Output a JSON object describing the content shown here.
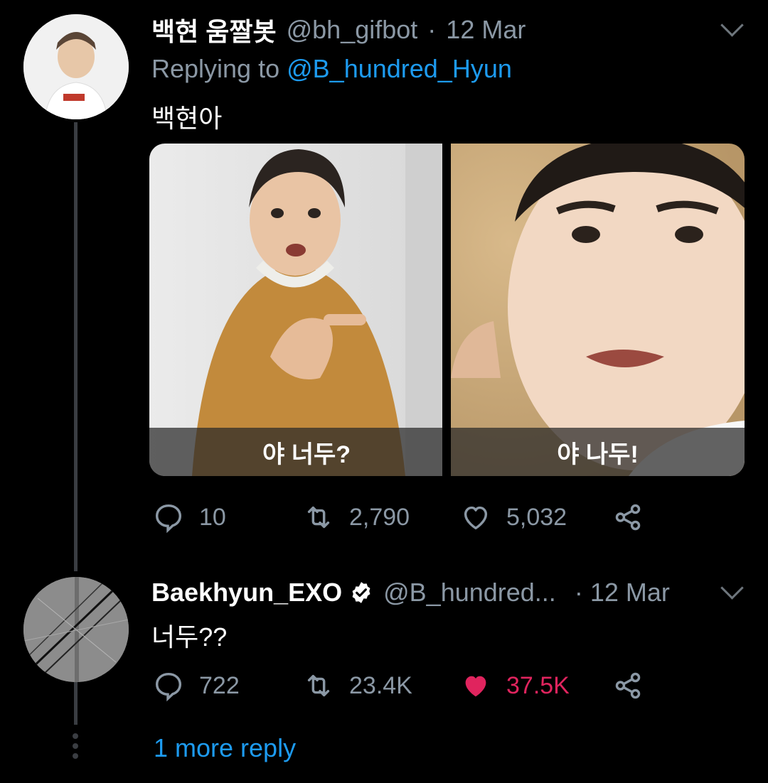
{
  "tweet1": {
    "display_name": "백현 움짤봇",
    "handle": "@bh_gifbot",
    "dot": "·",
    "date": "12 Mar",
    "replying_prefix": "Replying to ",
    "replying_to": "@B_hundred_Hyun",
    "text": "백현아",
    "image_left_caption": "야 너두?",
    "image_right_caption": "야 나두!",
    "replies": "10",
    "retweets": "2,790",
    "likes": "5,032"
  },
  "tweet2": {
    "display_name": "Baekhyun_EXO",
    "handle": "@B_hundred...",
    "dot": "·",
    "date": "12 Mar",
    "text": "너두??",
    "replies": "722",
    "retweets": "23.4K",
    "likes": "37.5K",
    "liked": true
  },
  "more_replies": "1 more reply",
  "colors": {
    "accent": "#1d9bf0",
    "like": "#e0245e",
    "muted": "#8b98a5"
  },
  "icons": [
    "reply-icon",
    "retweet-icon",
    "like-icon",
    "share-icon",
    "verified-badge-icon",
    "chevron-down-icon"
  ]
}
